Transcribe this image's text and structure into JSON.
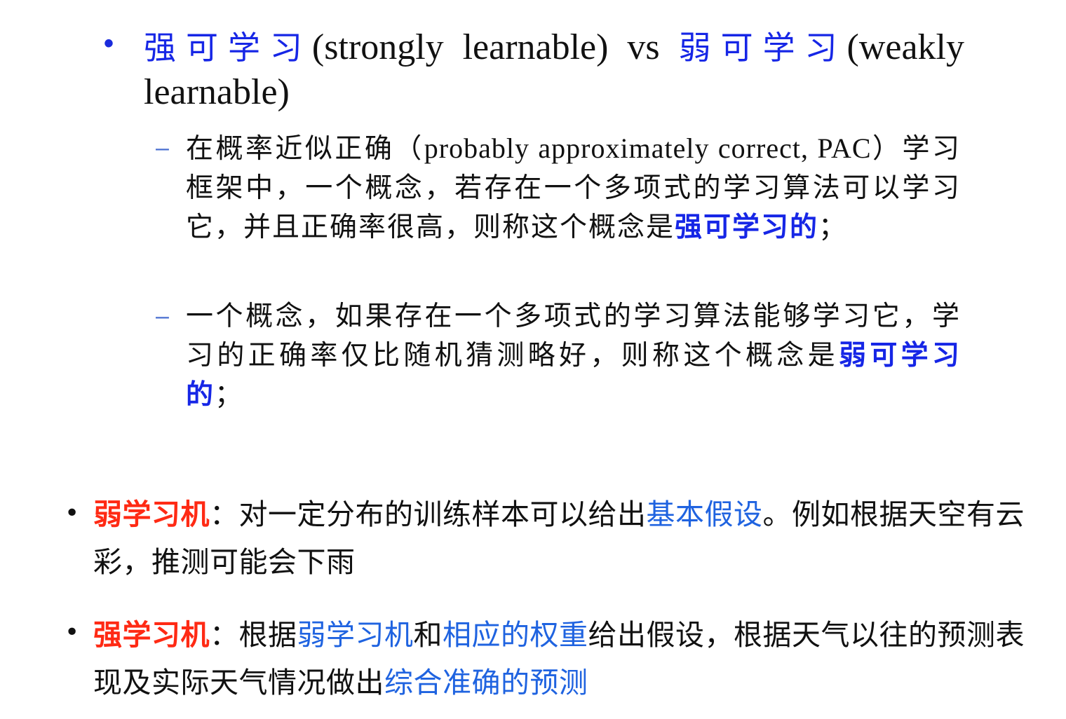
{
  "slide": {
    "top": {
      "term1": "强可学习",
      "part1": "(strongly learnable) vs ",
      "term2": "弱可学习",
      "part2": "(weakly learnable)"
    },
    "sub1": {
      "a": "在概率近似正确（",
      "latin": "probably approximately correct, PAC",
      "b": "）学习框架中，一个概念，若存在一个多项式的学习算法可以学习它，并且正确率很高，则称这个概念是",
      "term": "强可学习的",
      "end": "；"
    },
    "sub2": {
      "a": "一个概念，如果存在一个多项式的学习算法能够学习它，学习的正确率仅比随机猜测略好，则称这个概念是",
      "term": "弱可学习的",
      "end": "；"
    },
    "weak_learner": {
      "title": "弱学习机",
      "a": "：对一定分布的训练样本可以给出",
      "term": "基本假设",
      "b": "。例如根据天空有云彩，推测可能会下雨"
    },
    "strong_learner": {
      "title": "强学习机",
      "a": "：根据",
      "term1": "弱学习机",
      "b": "和",
      "term2": "相应的权重",
      "c": "给出假设，根据天气以往的预测表现及实际天气情况做出",
      "term3": "综合准确的预测"
    },
    "colors": {
      "term_blue": "#1626e6",
      "link_blue": "#1f63e0",
      "title_red": "#ff2a14"
    }
  }
}
